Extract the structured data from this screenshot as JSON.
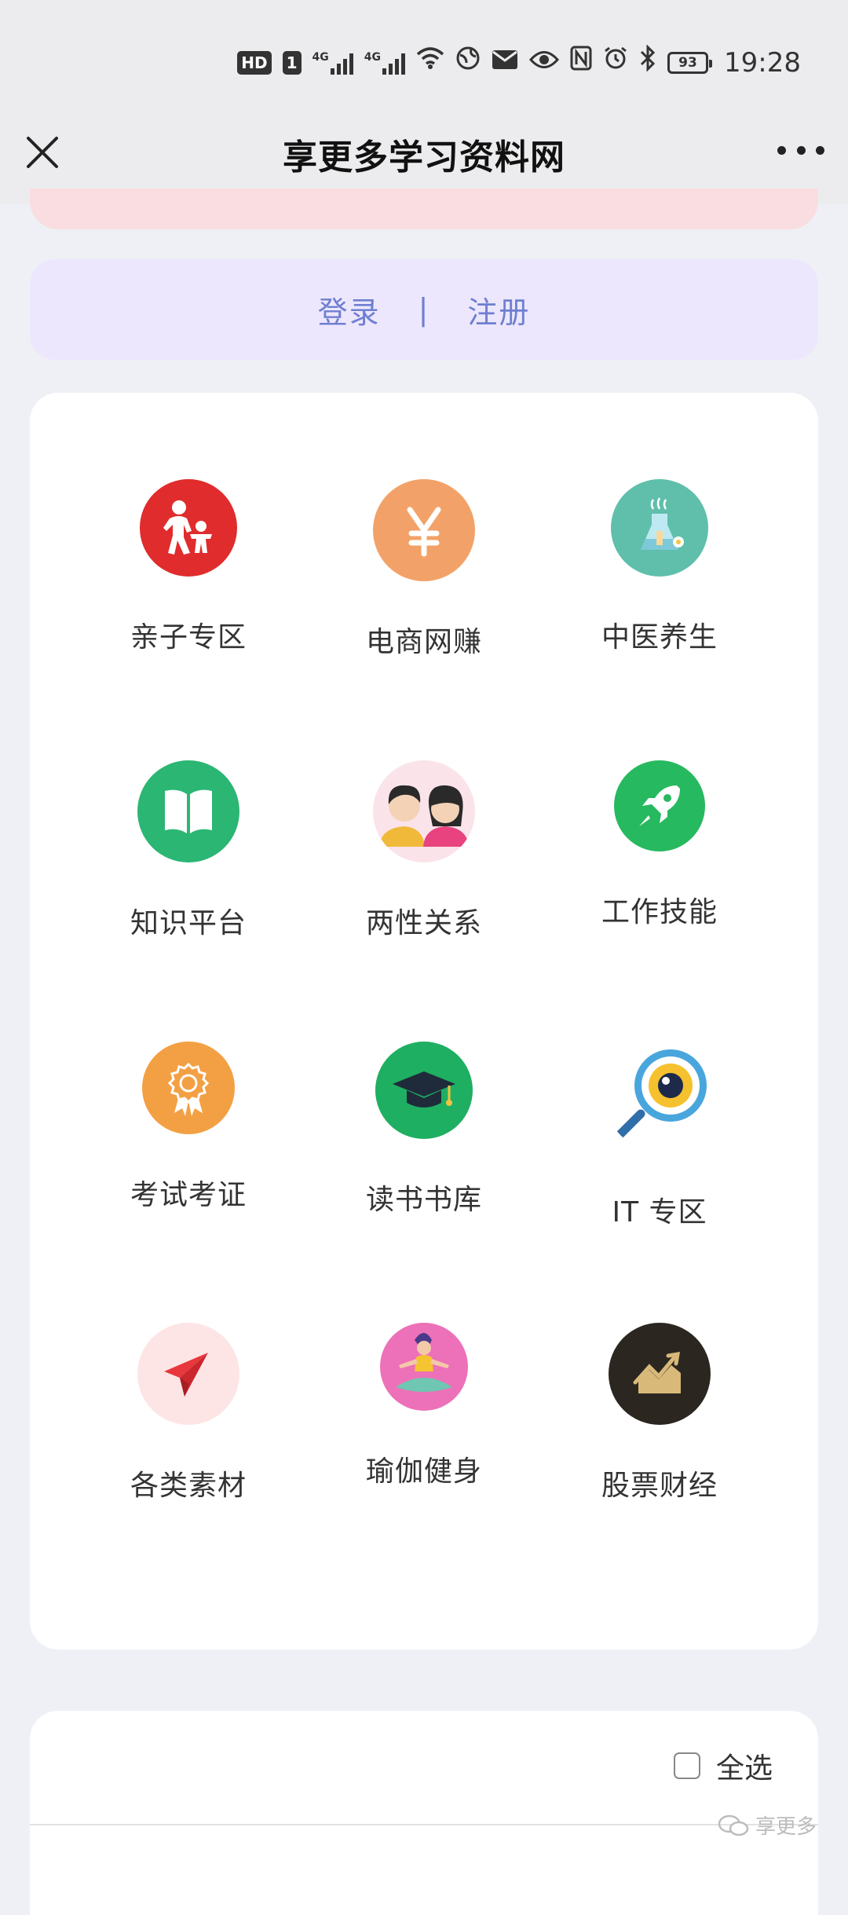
{
  "status_bar": {
    "badge": "HD",
    "sim": "1",
    "network": "4G",
    "battery": "93",
    "time": "19:28"
  },
  "nav": {
    "title": "享更多学习资料网",
    "close_icon": "close-icon",
    "more_icon": "more-dots-icon"
  },
  "auth": {
    "login": "登录",
    "separator": "|",
    "register": "注册"
  },
  "categories": [
    {
      "label": "亲子专区",
      "icon": "parent-child-icon",
      "color": "#e02c2c"
    },
    {
      "label": "电商网赚",
      "icon": "yen-icon",
      "color": "#f2a268"
    },
    {
      "label": "中医养生",
      "icon": "herbal-flask-icon",
      "color": "#5fbfaa"
    },
    {
      "label": "知识平台",
      "icon": "open-book-icon",
      "color": "#2bb673"
    },
    {
      "label": "两性关系",
      "icon": "couple-icon",
      "color": "#fbe3ea"
    },
    {
      "label": "工作技能",
      "icon": "rocket-icon",
      "color": "#27b95f"
    },
    {
      "label": "考试考证",
      "icon": "badge-icon",
      "color": "#f3a044"
    },
    {
      "label": "读书书库",
      "icon": "graduation-cap-icon",
      "color": "#1faf62"
    },
    {
      "label": "IT 专区",
      "icon": "magnifier-icon",
      "color": "#49a6dd"
    },
    {
      "label": "各类素材",
      "icon": "paper-plane-icon",
      "color": "#fde5e6"
    },
    {
      "label": "瑜伽健身",
      "icon": "yoga-icon",
      "color": "#ec71b8"
    },
    {
      "label": "股票财经",
      "icon": "stock-chart-icon",
      "color": "#2b2620"
    }
  ],
  "select_all": {
    "label": "全选",
    "checked": false
  },
  "watermark": "享更多"
}
